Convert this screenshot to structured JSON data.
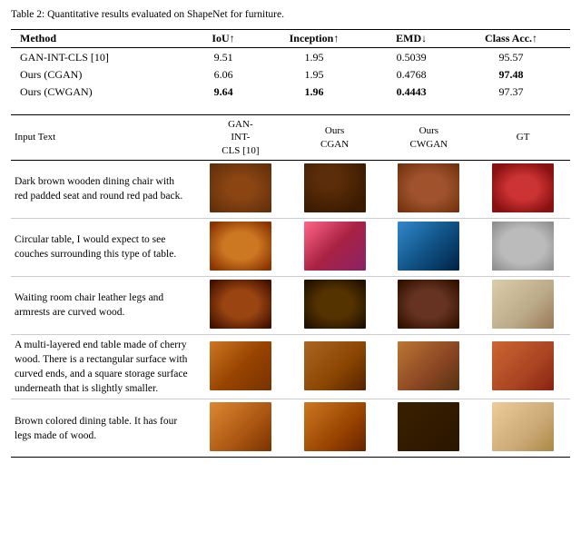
{
  "title": "Table 2: Quantitative results evaluated on ShapeNet for furniture.",
  "metrics_table": {
    "columns": [
      "Method",
      "IoU↑",
      "Inception↑",
      "EMD↓",
      "Class Acc.↑"
    ],
    "rows": [
      {
        "method": "GAN-INT-CLS [10]",
        "iou": "9.51",
        "inception": "1.95",
        "emd": "0.5039",
        "class_acc": "95.57",
        "bold": []
      },
      {
        "method": "Ours (CGAN)",
        "iou": "6.06",
        "inception": "1.95",
        "emd": "0.4768",
        "class_acc": "97.48",
        "bold": [
          "class_acc"
        ]
      },
      {
        "method": "Ours (CWGAN)",
        "iou": "9.64",
        "inception": "1.96",
        "emd": "0.4443",
        "class_acc": "97.37",
        "bold": [
          "iou",
          "inception",
          "emd"
        ]
      }
    ]
  },
  "qual_table": {
    "columns": [
      "Input Text",
      "GAN-INT-CLS [10]",
      "Ours CGAN",
      "Ours CWGAN",
      "GT"
    ],
    "rows": [
      {
        "text": "Dark brown wooden dining chair with red padded seat and round red pad back.",
        "img_classes": [
          "img-gan-chair",
          "img-cgan-chair",
          "img-cwgan-chair",
          "img-gt-chair"
        ]
      },
      {
        "text": "Circular table, I would expect to see couches surrounding this type of table.",
        "img_classes": [
          "img-gan-ctable",
          "img-cgan-ctable",
          "img-cwgan-ctable",
          "img-gt-ctable"
        ]
      },
      {
        "text": "Waiting room chair leather legs and armrests are curved wood.",
        "img_classes": [
          "img-gan-wchair",
          "img-cgan-wchair",
          "img-cwgan-wchair",
          "img-gt-wchair"
        ]
      },
      {
        "text": "A multi-layered end table made of cherry wood. There is a rectangular surface with curved ends, and a square storage surface underneath that is slightly smaller.",
        "img_classes": [
          "img-gan-etable",
          "img-cgan-etable",
          "img-cwgan-etable",
          "img-gt-etable"
        ]
      },
      {
        "text": "Brown colored dining table. It has four legs made of wood.",
        "img_classes": [
          "img-gan-dtable",
          "img-cgan-dtable",
          "img-cwgan-dtable",
          "img-gt-dtable"
        ]
      }
    ]
  }
}
